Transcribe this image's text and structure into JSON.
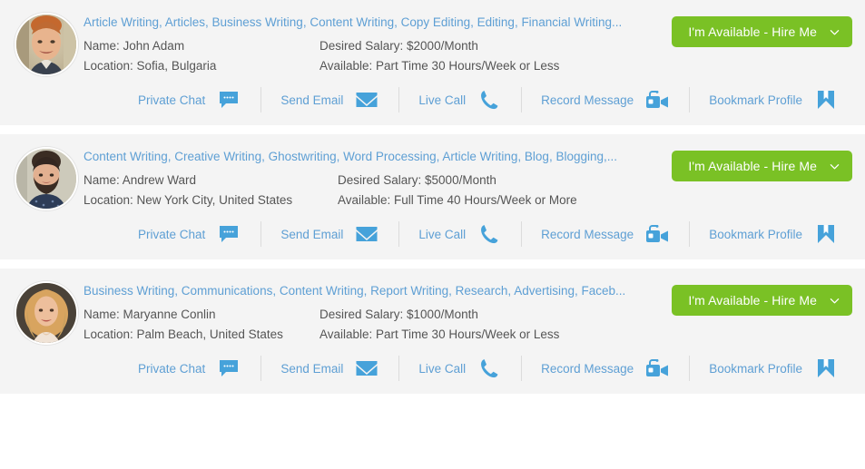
{
  "page": {
    "accent_link_color": "#5e9fd4",
    "icon_color": "#46a2da",
    "hire_button_color": "#7ac125",
    "card_background": "#f4f4f4",
    "body_text_color": "#555555"
  },
  "labels": {
    "name_prefix": "Name:",
    "location_prefix": "Location:",
    "salary_prefix": "Desired Salary:",
    "available_prefix": "Available:"
  },
  "actions": [
    {
      "label": "Private Chat",
      "icon": "chat-bubble-icon"
    },
    {
      "label": "Send Email",
      "icon": "envelope-icon"
    },
    {
      "label": "Live Call",
      "icon": "phone-icon"
    },
    {
      "label": "Record Message",
      "icon": "video-camera-icon"
    },
    {
      "label": "Bookmark Profile",
      "icon": "bookmark-icon"
    }
  ],
  "cards": [
    {
      "skills": "Article Writing, Articles, Business Writing, Content Writing, Copy Editing, Editing, Financial Writing...",
      "name": "Name: John Adam",
      "location": "Location: Sofia, Bulgaria",
      "salary": "Desired Salary: $2000/Month",
      "available": "Available: Part Time 30 Hours/Week or Less",
      "hire_label": "I'm Available - Hire Me",
      "avatar": "photo-john-adam"
    },
    {
      "skills": "Content Writing, Creative Writing, Ghostwriting, Word Processing, Article Writing, Blog, Blogging,...",
      "name": "Name: Andrew Ward",
      "location": "Location: New York City, United States",
      "salary": "Desired Salary: $5000/Month",
      "available": "Available: Full Time 40 Hours/Week or More",
      "hire_label": "I'm Available - Hire Me",
      "avatar": "photo-andrew-ward"
    },
    {
      "skills": "Business Writing, Communications, Content Writing, Report Writing, Research, Advertising, Faceb...",
      "name": "Name: Maryanne Conlin",
      "location": "Location: Palm Beach, United States",
      "salary": "Desired Salary: $1000/Month",
      "available": "Available: Part Time 30 Hours/Week or Less",
      "hire_label": "I'm Available - Hire Me",
      "avatar": "photo-maryanne-conlin"
    }
  ]
}
